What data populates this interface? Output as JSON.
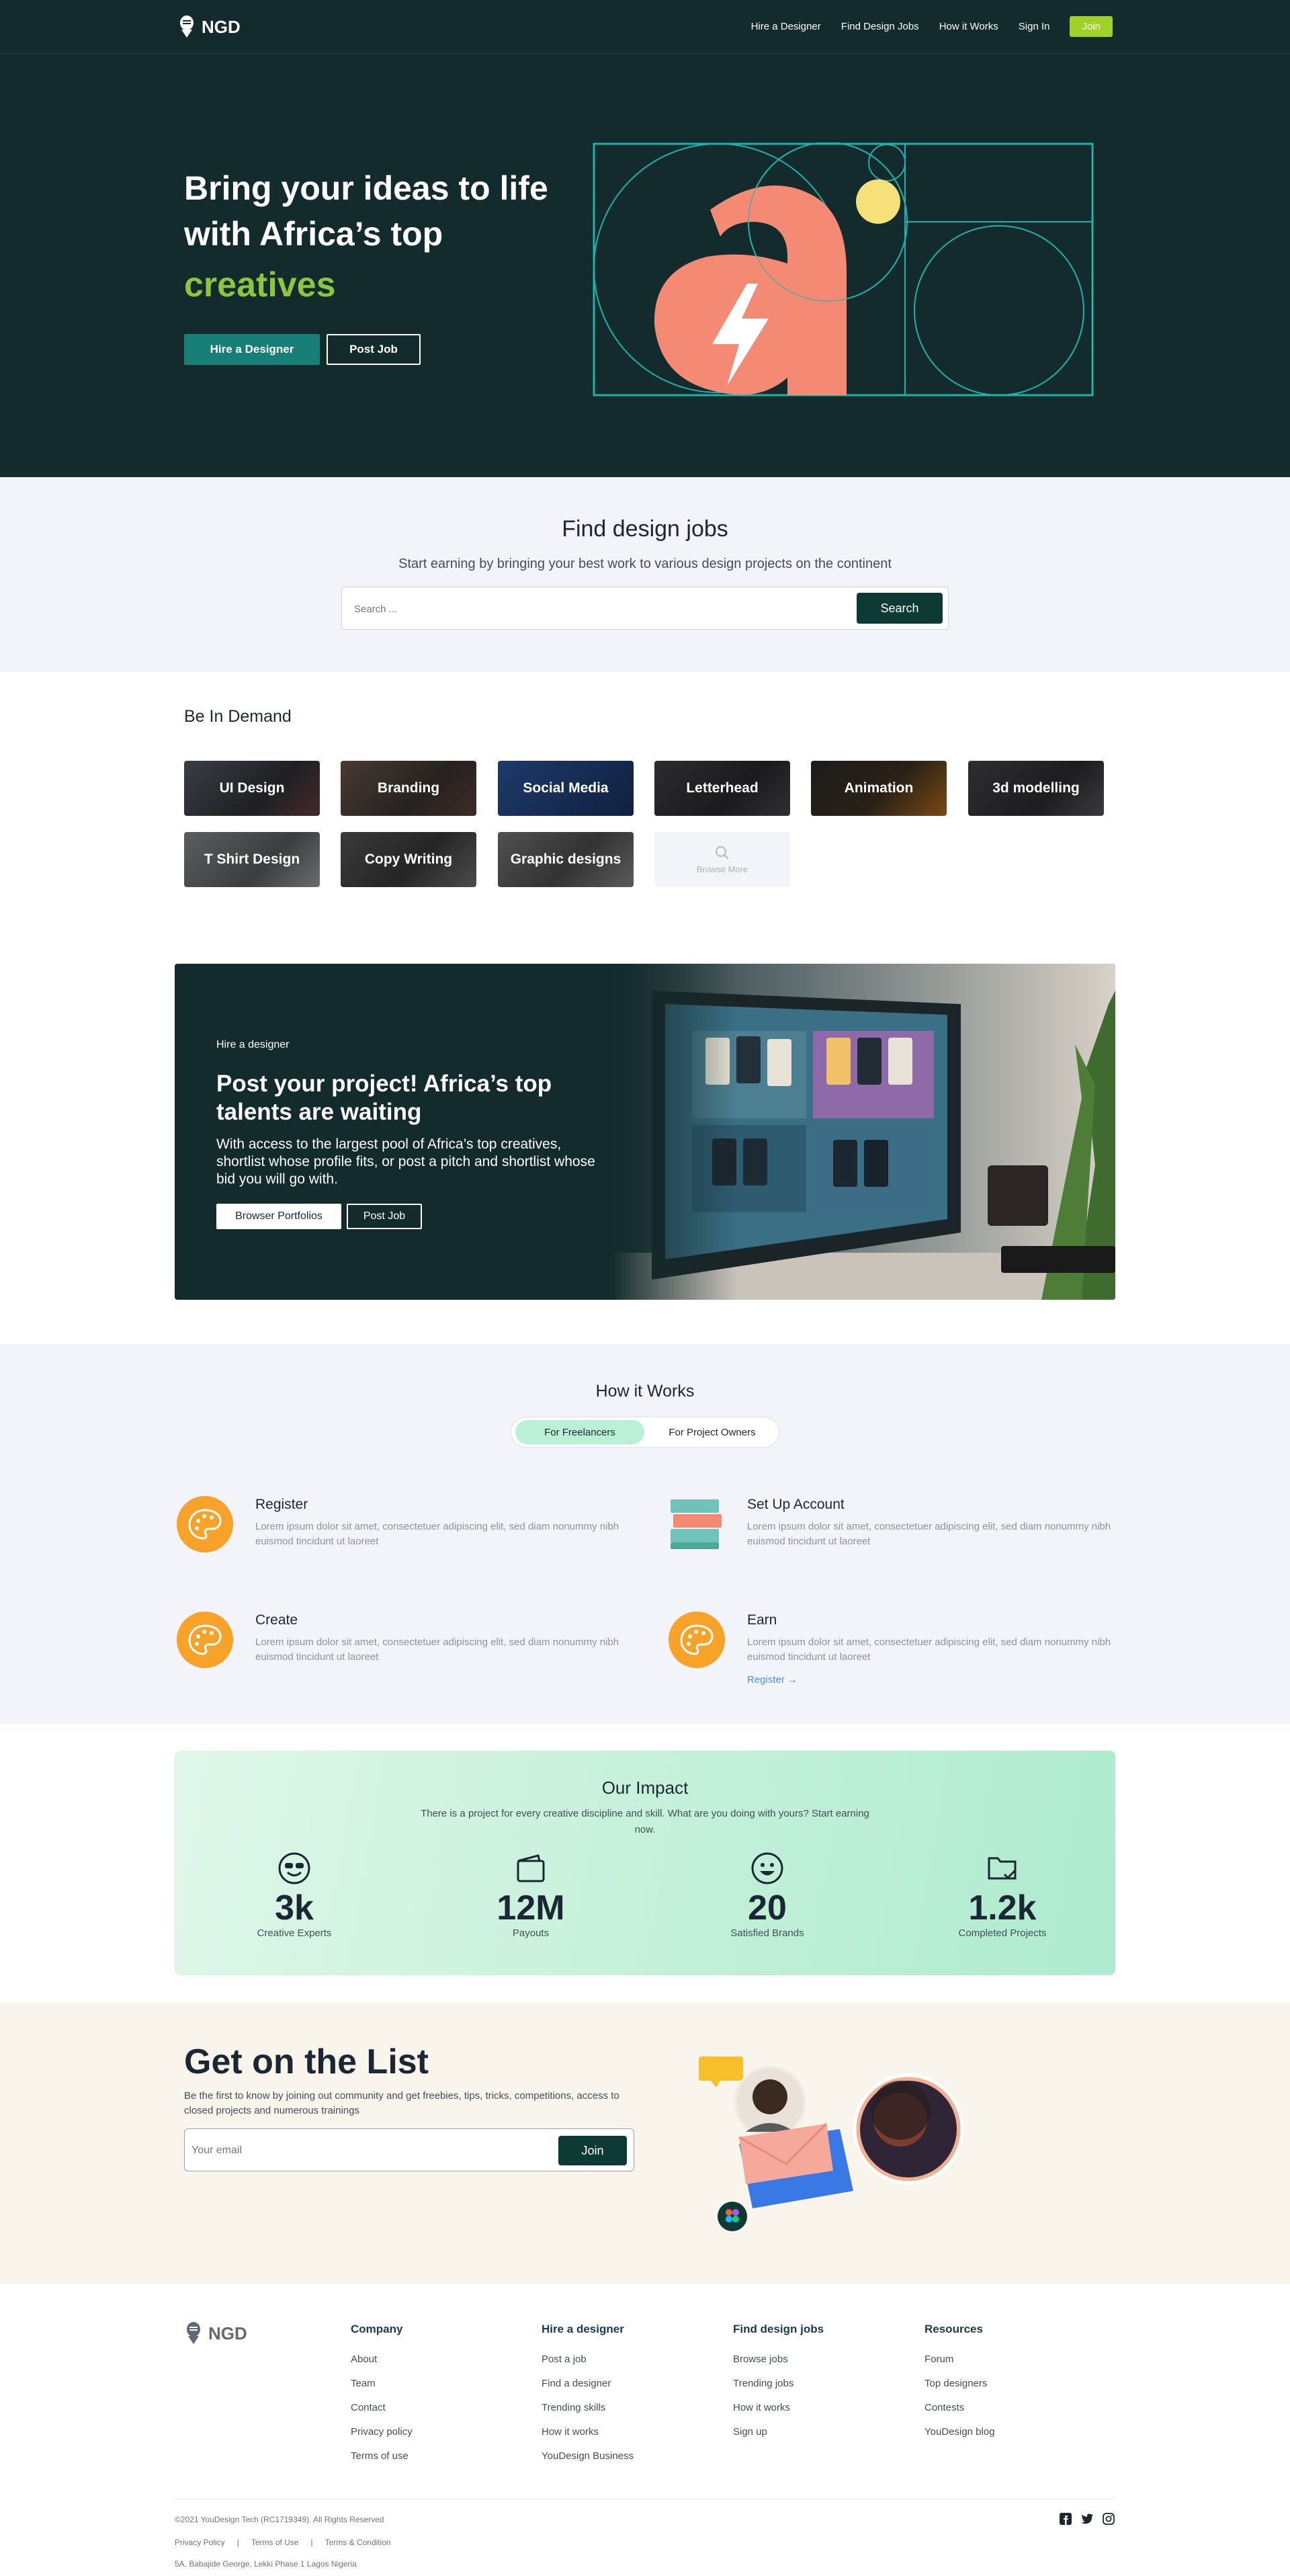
{
  "nav": {
    "logo_text": "NGD",
    "links": [
      "Hire a Designer",
      "Find Design Jobs",
      "How it Works",
      "Sign In"
    ],
    "join_label": "Join"
  },
  "hero": {
    "title": "Bring your ideas to life with Africa’s top",
    "accent": "creatives",
    "primary_button": "Hire a Designer",
    "secondary_button": "Post Job"
  },
  "find_jobs": {
    "title": "Find design jobs",
    "subtitle": "Start earning by bringing your best work to various design projects on the continent",
    "search_placeholder": "Search ...",
    "search_button": "Search"
  },
  "demand": {
    "title": "Be In Demand",
    "categories": [
      "UI Design",
      "Branding",
      "Social Media",
      "Letterhead",
      "Animation",
      "3d modelling",
      "T Shirt Design",
      "Copy Writing",
      "Graphic designs"
    ],
    "browse_more": "Browse More"
  },
  "hire": {
    "tag": "Hire a designer",
    "title": "Post your project! Africa’s top talents are waiting",
    "description": "With access to the largest pool of Africa’s top creatives, shortlist whose profile fits, or post a pitch and shortlist whose bid you will go with.",
    "primary_button": "Browser Portfolios",
    "secondary_button": "Post Job"
  },
  "how": {
    "title": "How it Works",
    "tab_active": "For Freelancers",
    "tab_inactive": "For Project Owners",
    "steps": [
      {
        "title": "Register",
        "text": "Lorem ipsum dolor sit amet, consectetuer adipiscing elit, sed diam nonummy nibh euismod tincidunt ut laoreet"
      },
      {
        "title": "Set Up Account",
        "text": "Lorem ipsum dolor sit amet, consectetuer adipiscing elit, sed diam nonummy nibh euismod tincidunt ut laoreet"
      },
      {
        "title": "Create",
        "text": "Lorem ipsum dolor sit amet, consectetuer adipiscing elit, sed diam nonummy nibh euismod tincidunt ut laoreet"
      },
      {
        "title": "Earn",
        "text": "Lorem ipsum dolor sit amet, consectetuer adipiscing elit, sed diam nonummy nibh euismod tincidunt ut laoreet",
        "link": "Register →"
      }
    ]
  },
  "impact": {
    "title": "Our Impact",
    "subtitle": "There is a project for every creative discipline and skill. What are you doing with yours? Start earning now.",
    "stats": [
      {
        "value": "3k",
        "label": "Creative Experts",
        "icon": "sunglasses-smiley-icon"
      },
      {
        "value": "12M",
        "label": "Payouts",
        "icon": "wallet-icon"
      },
      {
        "value": "20",
        "label": "Satisfied Brands",
        "icon": "smiley-icon"
      },
      {
        "value": "1.2k",
        "label": "Completed Projects",
        "icon": "folder-check-icon"
      }
    ]
  },
  "newsletter": {
    "title": "Get on the List",
    "text": "Be the first to know by joining out community and get freebies, tips, tricks, competitions, access to closed projects and numerous trainings",
    "email_placeholder": "Your email",
    "join_button": "Join"
  },
  "footer": {
    "logo_text": "NGD",
    "columns": [
      {
        "title": "Company",
        "links": [
          "About",
          "Team",
          "Contact",
          "Privacy policy",
          "Terms of use"
        ]
      },
      {
        "title": "Hire a designer",
        "links": [
          "Post a job",
          "Find a designer",
          "Trending skills",
          "How it works",
          "YouDesign Business"
        ]
      },
      {
        "title": "Find design jobs",
        "links": [
          "Browse jobs",
          "Trending jobs",
          "How it works",
          "Sign up"
        ]
      },
      {
        "title": "Resources",
        "links": [
          "Forum",
          "Top designers",
          "Contests",
          "YouDesign blog"
        ]
      }
    ],
    "copyright": "©2021 YouDesign Tech (RC1719349). All Rights Reserved",
    "legal": [
      "Privacy Policy",
      "|",
      "Terms of Use",
      "|",
      "Terms & Condition"
    ],
    "address": "5A, Babajide George, Lekki Phase 1 Lagos Nigeria",
    "social": [
      "facebook-icon",
      "twitter-icon",
      "instagram-icon"
    ]
  },
  "colors": {
    "dark_teal": "#132b2c",
    "accent_green": "#9fd129",
    "teal_button": "#177e78",
    "coral": "#f58a74",
    "orange_icon": "#f7a228"
  }
}
